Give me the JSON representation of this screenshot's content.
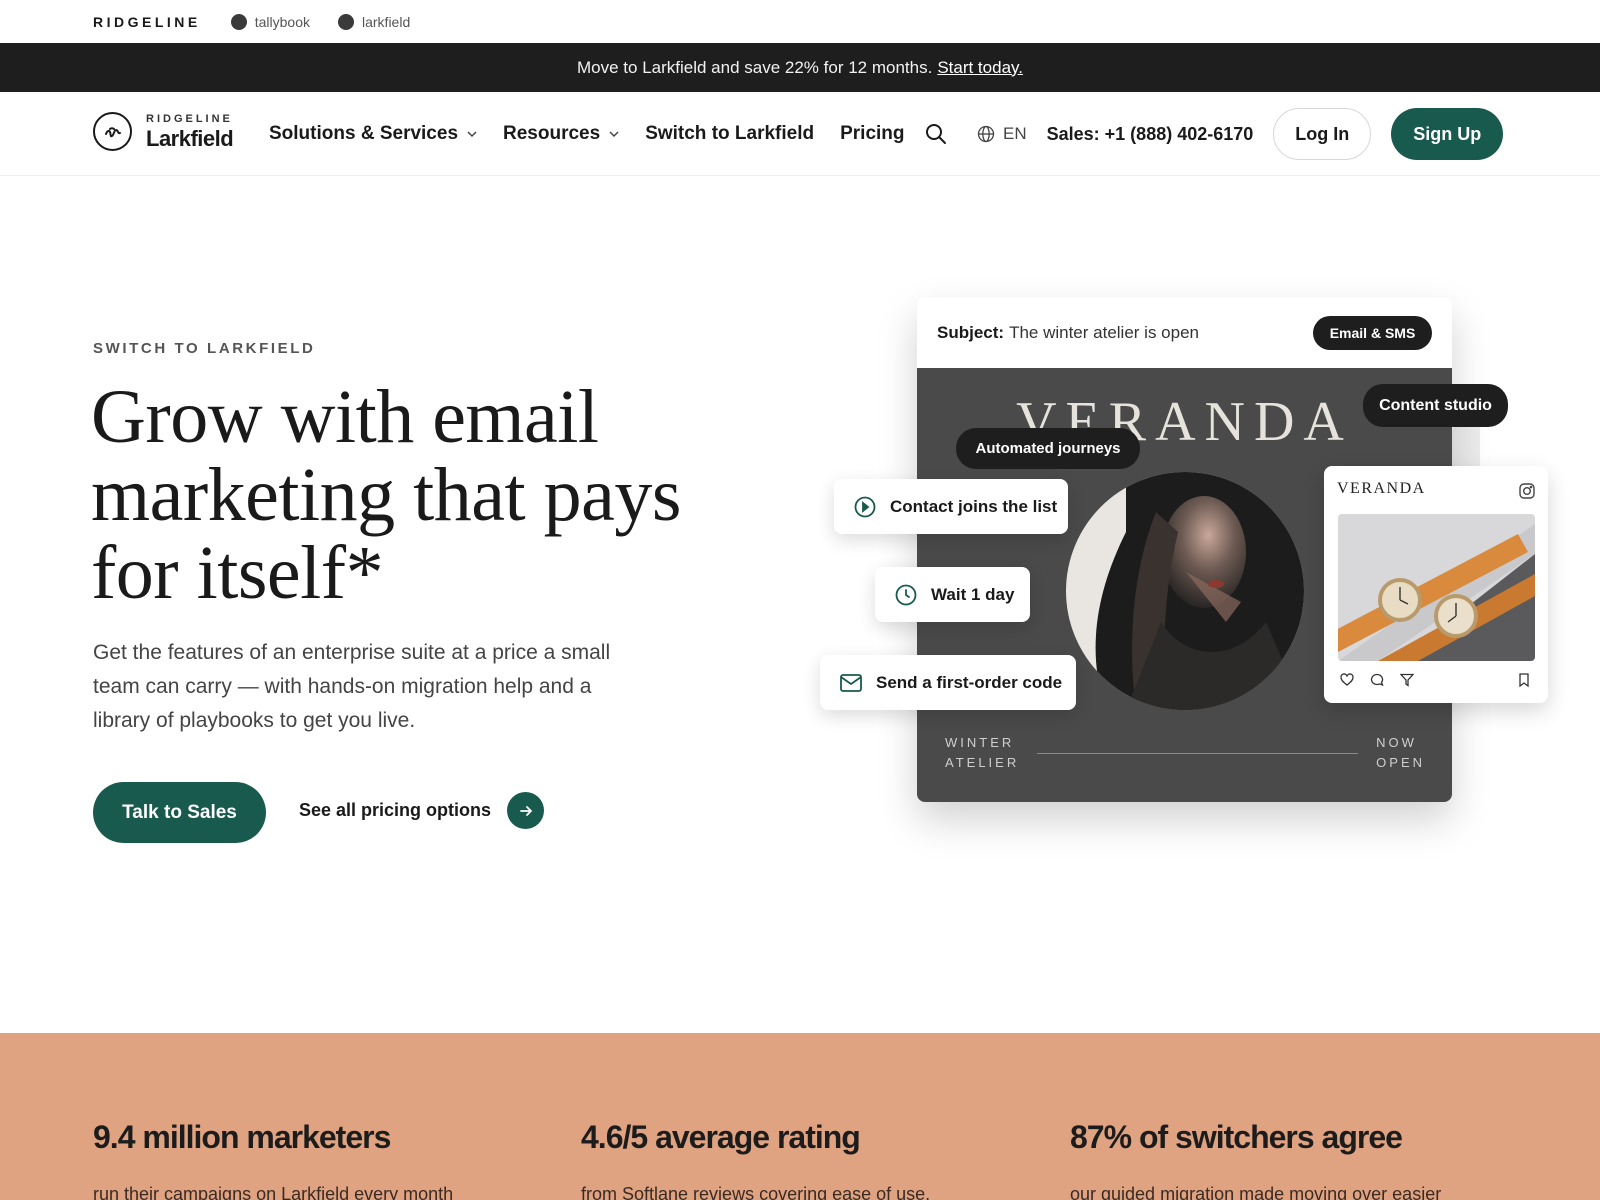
{
  "brand_strip": {
    "corporate": "RIDGELINE",
    "sub_brands": [
      "tallybook",
      "larkfield"
    ]
  },
  "promo": {
    "text": "Move to Larkfield and save 22% for 12 months.",
    "link": "Start today."
  },
  "nav": {
    "logo_small": "RIDGELINE",
    "logo_big": "Larkfield",
    "links": [
      {
        "label": "Solutions & Services",
        "dropdown": true
      },
      {
        "label": "Resources",
        "dropdown": true
      },
      {
        "label": "Switch to Larkfield",
        "dropdown": false
      },
      {
        "label": "Pricing",
        "dropdown": false
      }
    ],
    "language": "EN",
    "sales_phone": "Sales: +1 (888) 402-6170",
    "login": "Log In",
    "signup": "Sign Up"
  },
  "hero": {
    "eyebrow": "SWITCH TO LARKFIELD",
    "headline": "Grow with email marketing that pays for itself*",
    "lede": "Get the features of an enterprise suite at a price a small team can carry — with hands-on migration help and a library of playbooks to get you live.",
    "primary_cta": "Talk to Sales",
    "secondary_cta": "See all pricing options"
  },
  "illustration": {
    "subject_label": "Subject:",
    "subject_text": "The winter atelier is open",
    "channel_badge": "Email & SMS",
    "studio_badge": "Content studio",
    "journeys_badge": "Automated journeys",
    "brand_title": "VERANDA",
    "steps": [
      "Contact joins the list",
      "Wait 1 day",
      "Send a first-order code"
    ],
    "footer_left_1": "WINTER",
    "footer_left_2": "ATELIER",
    "footer_right_1": "NOW",
    "footer_right_2": "OPEN",
    "social_brand": "VERANDA"
  },
  "stats": [
    {
      "number": "9.4 million marketers",
      "desc": "run their campaigns on Larkfield every month"
    },
    {
      "number": "4.6/5 average rating",
      "desc": "from Softlane reviews covering ease of use,"
    },
    {
      "number": "87% of switchers agree",
      "desc": "our guided migration made moving over easier"
    }
  ],
  "colors": {
    "brand_green": "#185a4d",
    "promo_bg": "#1e1e1e",
    "stats_bg": "#e0a382"
  }
}
